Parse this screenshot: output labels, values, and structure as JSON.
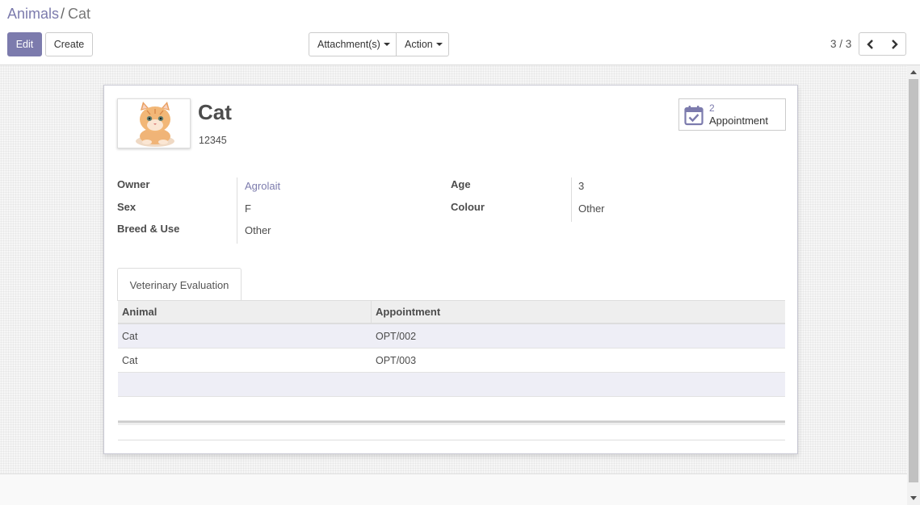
{
  "breadcrumb": {
    "parent": "Animals",
    "separator": "/",
    "current": "Cat"
  },
  "toolbar": {
    "edit_label": "Edit",
    "create_label": "Create",
    "attachments_label": "Attachment(s)",
    "action_label": "Action"
  },
  "pager": {
    "value": "3 / 3"
  },
  "record": {
    "name": "Cat",
    "reference": "12345"
  },
  "smart_button": {
    "count": "2",
    "label": "Appointment"
  },
  "fields": {
    "owner_label": "Owner",
    "owner_value": "Agrolait",
    "sex_label": "Sex",
    "sex_value": "F",
    "breed_label": "Breed & Use",
    "breed_value": "Other",
    "age_label": "Age",
    "age_value": "3",
    "colour_label": "Colour",
    "colour_value": "Other"
  },
  "tabs": [
    {
      "label": "Veterinary Evaluation"
    }
  ],
  "table": {
    "columns": [
      "Animal",
      "Appointment"
    ],
    "rows": [
      {
        "animal": "Cat",
        "appointment": "OPT/002"
      },
      {
        "animal": "Cat",
        "appointment": "OPT/003"
      }
    ]
  },
  "colors": {
    "brand": "#7c7bad"
  },
  "icons": {
    "stat": "calendar-check-icon",
    "prev": "chevron-left-icon",
    "next": "chevron-right-icon"
  }
}
